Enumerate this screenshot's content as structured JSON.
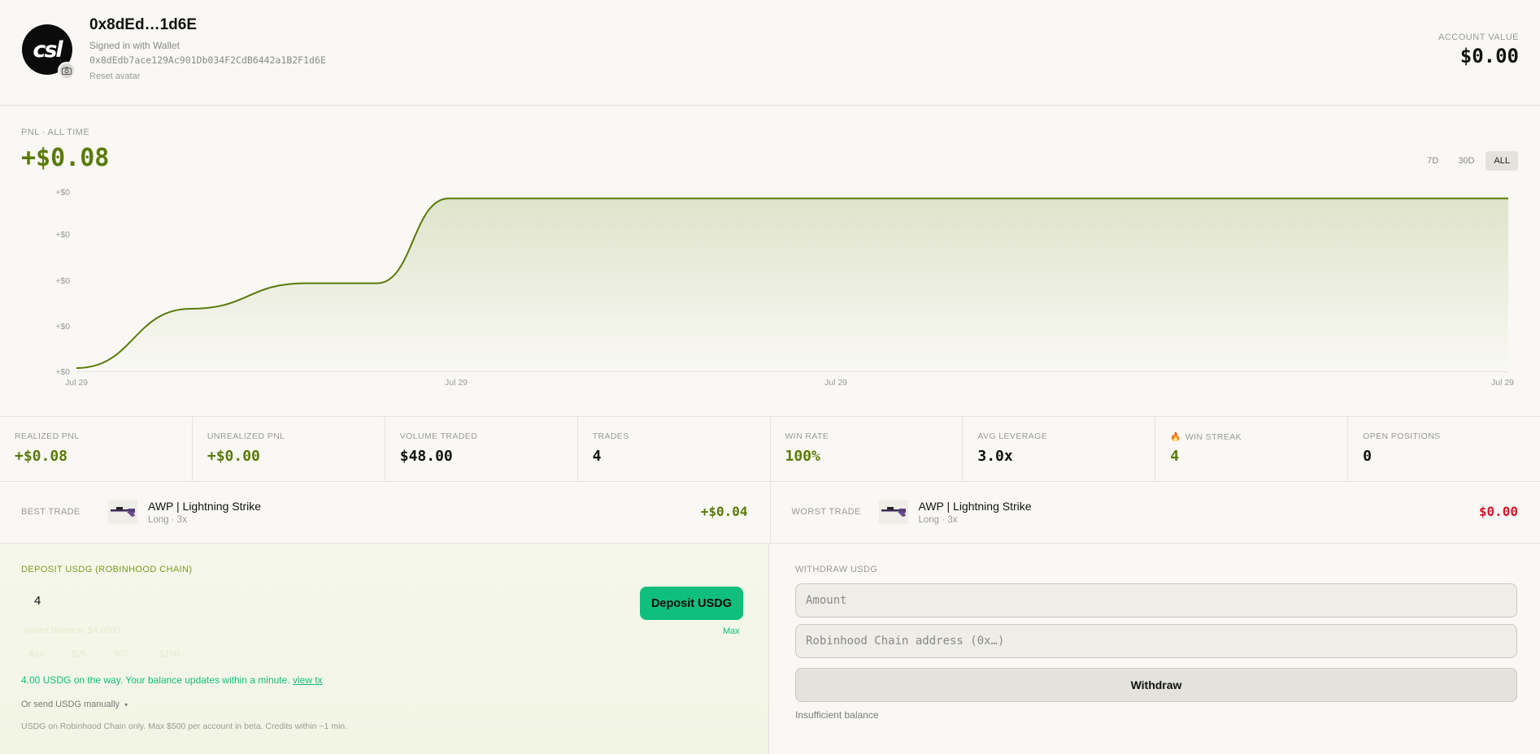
{
  "header": {
    "avatar_text": "csl",
    "username": "0x8dEd…1d6E",
    "signed_in": "Signed in with Wallet",
    "address": "0x8dEdb7ace129Ac901Db034F2CdB6442a1B2F1d6E",
    "reset_avatar": "Reset avatar",
    "account_value_label": "ACCOUNT VALUE",
    "account_value": "$0.00"
  },
  "pnl": {
    "label": "PNL · ALL TIME",
    "value": "+$0.08",
    "ranges": [
      {
        "label": "7D",
        "active": false
      },
      {
        "label": "30D",
        "active": false
      },
      {
        "label": "ALL",
        "active": true
      }
    ]
  },
  "chart_data": {
    "type": "area",
    "title": "",
    "xlabel": "",
    "ylabel": "",
    "x_ticks": [
      "Jul 29",
      "Jul 29",
      "Jul 29",
      "Jul 29"
    ],
    "y_ticks": [
      "+$0",
      "+$0",
      "+$0",
      "+$0",
      "+$0"
    ],
    "ylim": [
      0,
      0.08
    ],
    "grid": false,
    "series": [
      {
        "x": [
          0,
          0.08,
          0.16,
          0.21,
          0.26,
          1.0
        ],
        "values": [
          0.0,
          0.028,
          0.04,
          0.04,
          0.08,
          0.08
        ]
      }
    ],
    "colors": {
      "line": "#5a7a0a",
      "fill": "#dfe4cc"
    }
  },
  "stats": [
    {
      "label": "REALIZED PNL",
      "value": "+$0.08",
      "tone": "green",
      "icon": ""
    },
    {
      "label": "UNREALIZED PNL",
      "value": "+$0.00",
      "tone": "green",
      "icon": ""
    },
    {
      "label": "VOLUME TRADED",
      "value": "$48.00",
      "tone": "",
      "icon": ""
    },
    {
      "label": "TRADES",
      "value": "4",
      "tone": "",
      "icon": ""
    },
    {
      "label": "WIN RATE",
      "value": "100%",
      "tone": "green",
      "icon": ""
    },
    {
      "label": "AVG LEVERAGE",
      "value": "3.0x",
      "tone": "",
      "icon": ""
    },
    {
      "label": "WIN STREAK",
      "value": "4",
      "tone": "green",
      "icon": "fire-icon"
    },
    {
      "label": "OPEN POSITIONS",
      "value": "0",
      "tone": "",
      "icon": ""
    }
  ],
  "best_trade": {
    "label": "BEST TRADE",
    "name": "AWP | Lightning Strike",
    "sub": "Long · 3x",
    "pnl": "+$0.04"
  },
  "worst_trade": {
    "label": "WORST TRADE",
    "name": "AWP | Lightning Strike",
    "sub": "Long · 3x",
    "pnl": "$0.00"
  },
  "deposit": {
    "title": "DEPOSIT USDG (ROBINHOOD CHAIN)",
    "amount": "4",
    "button": "Deposit USDG",
    "max": "Max",
    "faint_balance": "Wallet balance: $4.0000",
    "faint_presets": [
      "$10",
      "$25",
      "$50",
      "$100"
    ],
    "status_text": "4.00 USDG on the way. Your balance updates within a minute.",
    "status_link": "view tx",
    "manual": "Or send USDG manually",
    "footnote": "USDG on Robinhood Chain only. Max $500 per account in beta. Credits within ~1 min."
  },
  "withdraw": {
    "title": "WITHDRAW USDG",
    "amount_placeholder": "Amount",
    "address_placeholder": "Robinhood Chain address (0x…)",
    "button": "Withdraw",
    "note": "Insufficient balance"
  },
  "colors": {
    "accent_green": "#5a7a0a",
    "deposit_green": "#0fbf7c",
    "loss_red": "#d4172d"
  }
}
